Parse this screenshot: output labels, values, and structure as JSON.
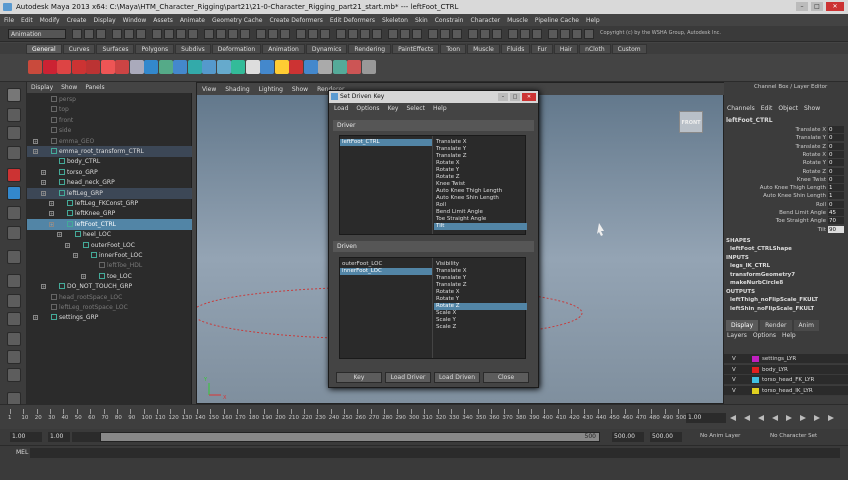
{
  "app": {
    "title": "Autodesk Maya 2013 x64: C:\\Maya\\HTM_Character_Rigging\\part21\\21-0-Character_Rigging_part21_start.mb*   ---   leftFoot_CTRL",
    "menu": [
      "File",
      "Edit",
      "Modify",
      "Create",
      "Display",
      "Window",
      "Assets",
      "Animate",
      "Geometry Cache",
      "Create Deformers",
      "Edit Deformers",
      "Skeleton",
      "Skin",
      "Constrain",
      "Character",
      "Muscle",
      "Pipeline Cache",
      "Help"
    ],
    "mode": "Animation",
    "status_info": "Copyright (c) by the WSHA Group, Autodesk Inc."
  },
  "shelf": {
    "tabs": [
      "General",
      "Curves",
      "Surfaces",
      "Polygons",
      "Subdivs",
      "Deformation",
      "Animation",
      "Dynamics",
      "Rendering",
      "PaintEffects",
      "Toon",
      "Muscle",
      "Fluids",
      "Fur",
      "Hair",
      "nCloth",
      "Custom"
    ],
    "active_tab": "General"
  },
  "outliner": {
    "menu": [
      "Display",
      "Show",
      "Panels"
    ],
    "rows": [
      {
        "label": "persp",
        "indent": 0,
        "dim": true,
        "expand": false
      },
      {
        "label": "top",
        "indent": 0,
        "dim": true,
        "expand": false
      },
      {
        "label": "front",
        "indent": 0,
        "dim": true,
        "expand": false
      },
      {
        "label": "side",
        "indent": 0,
        "dim": true,
        "expand": false
      },
      {
        "label": "emma_GEO",
        "indent": 0,
        "dim": true,
        "expand": true
      },
      {
        "label": "emma_root_transform_CTRL",
        "indent": 0,
        "dim": false,
        "expand": true,
        "hl": true
      },
      {
        "label": "body_CTRL",
        "indent": 1,
        "dim": false,
        "expand": false
      },
      {
        "label": "torso_GRP",
        "indent": 1,
        "dim": false,
        "expand": true
      },
      {
        "label": "head_neck_GRP",
        "indent": 1,
        "dim": false,
        "expand": true
      },
      {
        "label": "leftLeg_GRP",
        "indent": 1,
        "dim": false,
        "expand": true,
        "hl": true
      },
      {
        "label": "leftLeg_FKConst_GRP",
        "indent": 2,
        "dim": false,
        "expand": true
      },
      {
        "label": "leftKnee_GRP",
        "indent": 2,
        "dim": false,
        "expand": true
      },
      {
        "label": "leftFoot_CTRL",
        "indent": 2,
        "dim": false,
        "expand": true,
        "sel": true
      },
      {
        "label": "heel_LOC",
        "indent": 3,
        "dim": false,
        "expand": true
      },
      {
        "label": "outerFoot_LOC",
        "indent": 4,
        "dim": false,
        "expand": true
      },
      {
        "label": "innerFoot_LOC",
        "indent": 5,
        "dim": false,
        "expand": true
      },
      {
        "label": "leftToe_HDL",
        "indent": 6,
        "dim": true,
        "expand": false
      },
      {
        "label": "toe_LOC",
        "indent": 6,
        "dim": false,
        "expand": true
      },
      {
        "label": "DO_NOT_TOUCH_GRP",
        "indent": 1,
        "dim": false,
        "expand": true
      },
      {
        "label": "head_rootSpace_LOC",
        "indent": 0,
        "dim": true,
        "expand": false
      },
      {
        "label": "leftLeg_rootSpace_LOC",
        "indent": 0,
        "dim": true,
        "expand": false
      },
      {
        "label": "settings_GRP",
        "indent": 0,
        "dim": false,
        "expand": true
      }
    ]
  },
  "viewport": {
    "menu": [
      "View",
      "Shading",
      "Lighting",
      "Show",
      "Renderer"
    ],
    "cube_label": "FRONT",
    "axis_y": "Y",
    "axis_x": "X"
  },
  "dialog": {
    "title": "Set Driven Key",
    "menu": [
      "Load",
      "Options",
      "Key",
      "Select",
      "Help"
    ],
    "driver_label": "Driver",
    "driven_label": "Driven",
    "driver_objects": [
      {
        "label": "leftFoot_CTRL",
        "sel": true
      }
    ],
    "driver_attrs": [
      {
        "label": "Translate X"
      },
      {
        "label": "Translate Y"
      },
      {
        "label": "Translate Z"
      },
      {
        "label": "Rotate X"
      },
      {
        "label": "Rotate Y"
      },
      {
        "label": "Rotate Z"
      },
      {
        "label": "Knee Twist"
      },
      {
        "label": "Auto Knee Thigh Length"
      },
      {
        "label": "Auto Knee Shin Length"
      },
      {
        "label": "Roll"
      },
      {
        "label": "Bend Limit Angle"
      },
      {
        "label": "Toe Straight Angle"
      },
      {
        "label": "Tilt",
        "sel": true
      }
    ],
    "driven_objects": [
      {
        "label": "outerFoot_LOC"
      },
      {
        "label": "innerFoot_LOC",
        "sel": true
      }
    ],
    "driven_attrs": [
      {
        "label": "Visibility"
      },
      {
        "label": "Translate X"
      },
      {
        "label": "Translate Y"
      },
      {
        "label": "Translate Z"
      },
      {
        "label": "Rotate X"
      },
      {
        "label": "Rotate Y"
      },
      {
        "label": "Rotate Z",
        "sel": true
      },
      {
        "label": "Scale X"
      },
      {
        "label": "Scale Y"
      },
      {
        "label": "Scale Z"
      }
    ],
    "buttons": {
      "key": "Key",
      "load_driver": "Load Driver",
      "load_driven": "Load Driven",
      "close": "Close"
    }
  },
  "channel_box": {
    "title": "Channel Box / Layer Editor",
    "menu": [
      "Channels",
      "Edit",
      "Object",
      "Show"
    ],
    "object": "leftFoot_CTRL",
    "channels": [
      {
        "label": "Translate X",
        "value": "0"
      },
      {
        "label": "Translate Y",
        "value": "0"
      },
      {
        "label": "Translate Z",
        "value": "0"
      },
      {
        "label": "Rotate X",
        "value": "0"
      },
      {
        "label": "Rotate Y",
        "value": "0"
      },
      {
        "label": "Rotate Z",
        "value": "0"
      },
      {
        "label": "Knee Twist",
        "value": "0"
      },
      {
        "label": "Auto Knee Thigh Length",
        "value": "1"
      },
      {
        "label": "Auto Knee Shin Length",
        "value": "1"
      },
      {
        "label": "Roll",
        "value": "0"
      },
      {
        "label": "Bend Limit Angle",
        "value": "45"
      },
      {
        "label": "Toe Straight Angle",
        "value": "70"
      },
      {
        "label": "Tilt",
        "value": "90",
        "active": true
      }
    ],
    "shapes_header": "SHAPES",
    "shape": "leftFoot_CTRLShape",
    "inputs_header": "INPUTS",
    "inputs": [
      "legs_IK_CTRL",
      "transformGeometry7",
      "makeNurbCircle8"
    ],
    "outputs_header": "OUTPUTS",
    "outputs": [
      "leftThigh_noFlipScale_FKULT",
      "leftShin_noFlipScale_FKULT"
    ],
    "layer_tabs": [
      "Display",
      "Render",
      "Anim"
    ],
    "layer_menu": [
      "Layers",
      "Options",
      "Help"
    ],
    "layers": [
      {
        "v": "V",
        "name": "settings_LYR",
        "color": "#c020c0"
      },
      {
        "v": "V",
        "name": "body_LYR",
        "color": "#e02020"
      },
      {
        "v": "V",
        "name": "torso_head_FK_LYR",
        "color": "#40c0e0"
      },
      {
        "v": "V",
        "name": "torso_head_IK_LYR",
        "color": "#e0d020"
      }
    ]
  },
  "timeline": {
    "tick_labels": [
      "1",
      "10",
      "20",
      "30",
      "40",
      "50",
      "60",
      "70",
      "80",
      "90",
      "100",
      "110",
      "120",
      "130",
      "140",
      "150",
      "160",
      "170",
      "180",
      "190",
      "200",
      "210",
      "220",
      "230",
      "240",
      "250",
      "260",
      "270",
      "280",
      "290",
      "300",
      "310",
      "320",
      "330",
      "340",
      "350",
      "360",
      "370",
      "380",
      "390",
      "400",
      "410",
      "420",
      "430",
      "440",
      "450",
      "460",
      "470",
      "480",
      "490",
      "500"
    ],
    "current_frame": "1.00",
    "range_start": "1.00",
    "range_start2": "1.00",
    "range_end_bar": "500",
    "range_end": "500.00",
    "range_end2": "500.00",
    "anim_layer": "No Anim Layer",
    "char_set": "No Character Set"
  },
  "command": {
    "label": "MEL"
  }
}
